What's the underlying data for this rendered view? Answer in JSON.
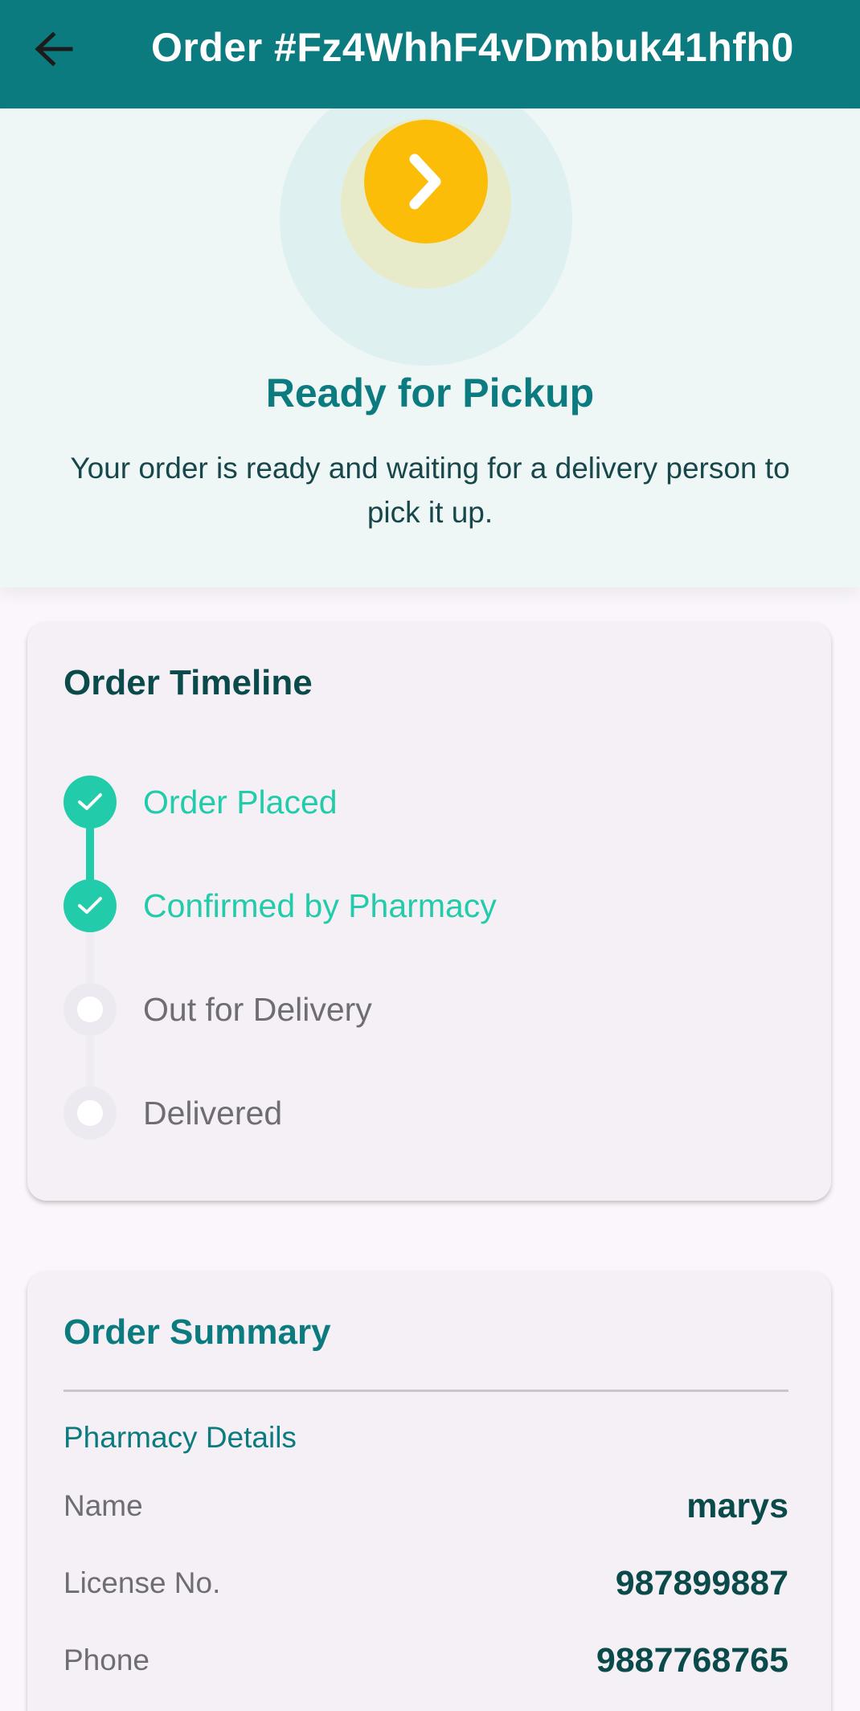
{
  "appbar": {
    "back_icon": "arrow-left-icon",
    "title": "Order #Fz4WhhF4vDmbuk41hfh0",
    "background": "#0c7b7f"
  },
  "status": {
    "icon": "chevron-right-icon",
    "icon_color": "#fbbd08",
    "title": "Ready for Pickup",
    "description": "Your order is ready and waiting for a delivery person to pick it up."
  },
  "timeline": {
    "title": "Order Timeline",
    "steps": [
      {
        "label": "Order Placed",
        "state": "done",
        "icon": "check-icon"
      },
      {
        "label": "Confirmed by Pharmacy",
        "state": "done",
        "icon": "check-icon"
      },
      {
        "label": "Out for Delivery",
        "state": "pending",
        "icon": "circle-icon"
      },
      {
        "label": "Delivered",
        "state": "pending",
        "icon": "circle-icon"
      }
    ],
    "done_color": "#22ccaa"
  },
  "summary": {
    "title": "Order Summary",
    "section": "Pharmacy Details",
    "rows": [
      {
        "key": "Name",
        "value": "marys"
      },
      {
        "key": "License No.",
        "value": "987899887"
      },
      {
        "key": "Phone",
        "value": "9887768765"
      }
    ]
  }
}
